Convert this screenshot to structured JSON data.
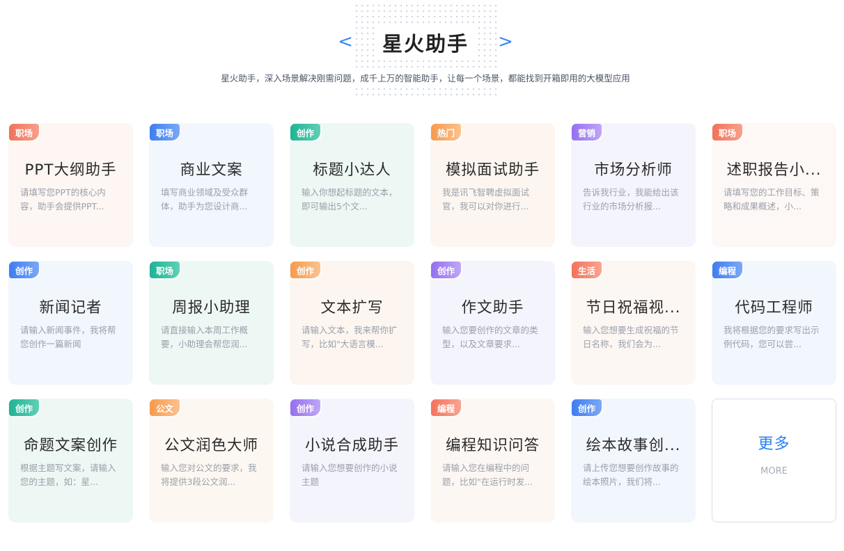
{
  "header": {
    "title": "星火助手",
    "subtitle": "星火助手，深入场景解决刚需问题，成千上万的智能助手，让每一个场景，都能找到开箱即用的大模型应用",
    "prev_label": "<",
    "next_label": ">"
  },
  "colors": {
    "accent": "#3a86f5",
    "tag_job": "#f27a5c",
    "tag_job_blue": "#4b86f0",
    "tag_create": "#23b899",
    "tag_hot": "#f7a15a",
    "tag_marketing": "#9b79f0",
    "tag_life": "#f7836a",
    "tag_code": "#4b86f0",
    "tag_official": "#f7a15a"
  },
  "cards": [
    {
      "tag": "职场",
      "title": "PPT大纲助手",
      "desc": "请填写您PPT的核心内容，助手会提供PPT..."
    },
    {
      "tag": "职场",
      "title": "商业文案",
      "desc": "填写商业领域及受众群体，助手为您设计商..."
    },
    {
      "tag": "创作",
      "title": "标题小达人",
      "desc": "输入你想起标题的文本，即可输出5个文..."
    },
    {
      "tag": "热门",
      "title": "模拟面试助手",
      "desc": "我是讯飞智聘虚拟面试官，我可以对你进行..."
    },
    {
      "tag": "营销",
      "title": "市场分析师",
      "desc": "告诉我行业，我能给出该行业的市场分析报..."
    },
    {
      "tag": "职场",
      "title": "述职报告小...",
      "desc": "请填写您的工作目标、策略和成果概述，小..."
    },
    {
      "tag": "创作",
      "title": "新闻记者",
      "desc": "请输入新闻事件，我将帮您创作一篇新闻"
    },
    {
      "tag": "职场",
      "title": "周报小助理",
      "desc": "请直接输入本周工作概要，小助理会帮您润..."
    },
    {
      "tag": "创作",
      "title": "文本扩写",
      "desc": "请输入文本，我来帮你扩写，比如\"大语言模..."
    },
    {
      "tag": "创作",
      "title": "作文助手",
      "desc": "输入您要创作的文章的类型，以及文章要求..."
    },
    {
      "tag": "生活",
      "title": "节日祝福视...",
      "desc": "输入您想要生成祝福的节日名称，我们会为..."
    },
    {
      "tag": "编程",
      "title": "代码工程师",
      "desc": "我将根据您的要求写出示例代码，您可以尝..."
    },
    {
      "tag": "创作",
      "title": "命题文案创作",
      "desc": "根据主题写文案，请输入您的主题，如：星..."
    },
    {
      "tag": "公文",
      "title": "公文润色大师",
      "desc": "输入您对公文的要求，我将提供3段公文润..."
    },
    {
      "tag": "创作",
      "title": "小说合成助手",
      "desc": "请输入您想要创作的小说主题"
    },
    {
      "tag": "编程",
      "title": "编程知识问答",
      "desc": "请输入您在编程中的问题，比如\"在运行时发..."
    },
    {
      "tag": "创作",
      "title": "绘本故事创...",
      "desc": "请上传您想要创作故事的绘本照片，我们将..."
    }
  ],
  "more": {
    "label": "更多",
    "sub": "MORE"
  }
}
